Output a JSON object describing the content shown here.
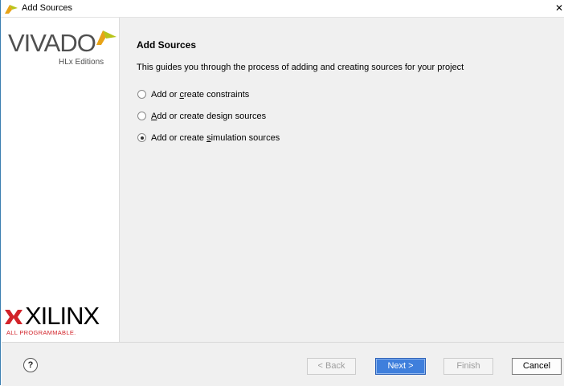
{
  "window": {
    "title": "Add Sources",
    "close_glyph": "✕"
  },
  "sidebar": {
    "vivado_word": "VIVADO",
    "vivado_sub": "HLx Editions",
    "xilinx_word": "XILINX",
    "xilinx_sub": "ALL PROGRAMMABLE."
  },
  "main": {
    "heading": "Add Sources",
    "description": "This guides you through the process of adding and creating sources for your project",
    "options": [
      {
        "pre": "Add or ",
        "mnemonic": "c",
        "post": "reate constraints",
        "checked": false
      },
      {
        "pre": "",
        "mnemonic": "A",
        "post": "dd or create design sources",
        "checked": false
      },
      {
        "pre": "Add or create ",
        "mnemonic": "s",
        "post": "imulation sources",
        "checked": true
      }
    ]
  },
  "footer": {
    "help": "?",
    "back": "< Back",
    "next": "Next >",
    "finish": "Finish",
    "cancel": "Cancel"
  },
  "colors": {
    "accent_blue": "#3f7fdc",
    "logo_yellow_green": "#b8c41a",
    "xilinx_red": "#d2232a"
  }
}
